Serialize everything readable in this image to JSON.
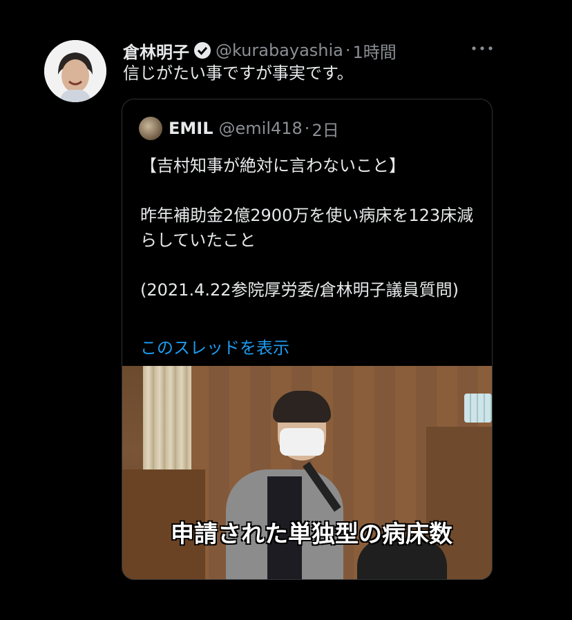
{
  "tweet": {
    "author_name": "倉林明子",
    "handle": "@kurabayashia",
    "separator": "·",
    "time": "1時間",
    "text": "信じがたい事ですが事実です。",
    "more_icon": "more-horizontal-icon",
    "verified_icon": "verified-badge-icon"
  },
  "quote": {
    "author_name": "EMIL",
    "handle": "@emil418",
    "separator": "·",
    "time": "2日",
    "lines": [
      "【吉村知事が絶対に言わないこと】",
      "",
      "昨年補助金2億2900万を使い病床を123床減らしていたこと",
      "",
      "(2021.4.22参院厚労委/倉林明子議員質問)"
    ],
    "show_thread": "このスレッドを表示",
    "media_caption": "申請された単独型の病床数"
  },
  "colors": {
    "link": "#1d9bf0",
    "muted": "#8b8f94",
    "border": "#2f3336"
  }
}
